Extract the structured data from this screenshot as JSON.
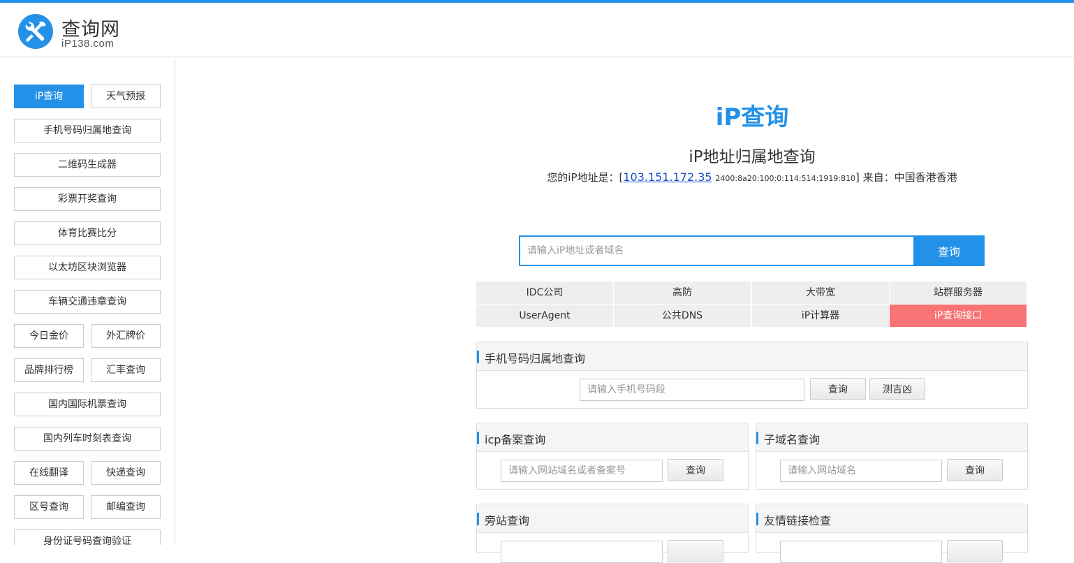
{
  "header": {
    "logo_name": "查询网",
    "logo_sub": "iP138.com",
    "brand_color": "#2491e8"
  },
  "sidebar": {
    "items": [
      {
        "label": "iP查询",
        "active": true
      },
      {
        "label": "天气预报"
      },
      {
        "label": "手机号码归属地查询"
      },
      {
        "label": "二维码生成器"
      },
      {
        "label": "彩票开奖查询"
      },
      {
        "label": "体育比赛比分"
      },
      {
        "label": "以太坊区块浏览器"
      },
      {
        "label": "车辆交通违章查询"
      },
      {
        "label": "今日金价"
      },
      {
        "label": "外汇牌价"
      },
      {
        "label": "品牌排行榜"
      },
      {
        "label": "汇率查询"
      },
      {
        "label": "国内国际机票查询"
      },
      {
        "label": "国内列车时刻表查询"
      },
      {
        "label": "在线翻译"
      },
      {
        "label": "快递查询"
      },
      {
        "label": "区号查询"
      },
      {
        "label": "邮编查询"
      },
      {
        "label": "身份证号码查询验证"
      }
    ]
  },
  "main": {
    "title": "iP查询",
    "subtitle": "iP地址归属地查询",
    "ip_prefix": "您的iP地址是：[",
    "ip_v4": "103.151.172.35",
    "ip_v6": "2400:8a20:100:0:114:514:1919:810",
    "ip_mid": "] 来自：",
    "ip_location": "中国香港香港",
    "search_placeholder": "请输入iP地址或者域名",
    "search_button": "查询",
    "quick_links": [
      "IDC公司",
      "高防",
      "大带宽",
      "站群服务器",
      "UserAgent",
      "公共DNS",
      "iP计算器",
      "iP查询接口"
    ]
  },
  "panels": {
    "phone": {
      "title": "手机号码归属地查询",
      "placeholder": "请输入手机号码段",
      "btn1": "查询",
      "btn2": "测吉凶"
    },
    "icp": {
      "title": "icp备案查询",
      "placeholder": "请输入网站域名或者备案号",
      "btn": "查询"
    },
    "subdomain": {
      "title": "子域名查询",
      "placeholder": "请输入网站域名",
      "btn": "查询"
    },
    "sidesite": {
      "title": "旁站查询"
    },
    "friendlink": {
      "title": "友情链接检查"
    }
  }
}
